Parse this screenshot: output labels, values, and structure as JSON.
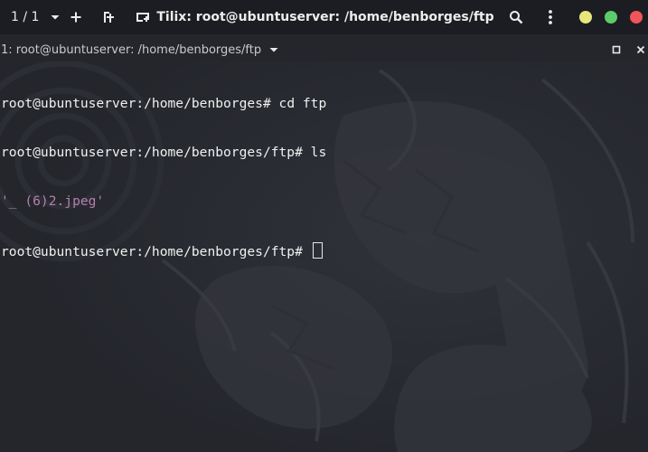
{
  "header": {
    "session_counter": "1 / 1",
    "title": "Tilix: root@ubuntuserver: /home/benborges/ftp",
    "window_controls": {
      "minimize_color": "#e4e87a",
      "maximize_color": "#5ccc6b",
      "close_color": "#f0555a"
    },
    "icons": [
      "chevron-down-icon",
      "plus-icon",
      "add-terminal-icon",
      "sidebar-icon",
      "search-icon",
      "menu-dots-icon"
    ]
  },
  "terminal_tab": {
    "label": "1: root@ubuntuserver: /home/benborges/ftp",
    "icons": [
      "chevron-down-icon",
      "maximize-icon",
      "close-icon"
    ]
  },
  "terminal": {
    "lines": [
      {
        "prompt": "root@ubuntuserver:/home/benborges# ",
        "command": "cd ftp"
      },
      {
        "prompt": "root@ubuntuserver:/home/benborges/ftp# ",
        "command": "ls"
      },
      {
        "output": "'_ (6)2.jpeg'"
      },
      {
        "prompt": "root@ubuntuserver:/home/benborges/ftp# ",
        "command": ""
      }
    ],
    "colors": {
      "text": "#f0f0f0",
      "file": "#b57fae",
      "background": "#24262c"
    }
  }
}
